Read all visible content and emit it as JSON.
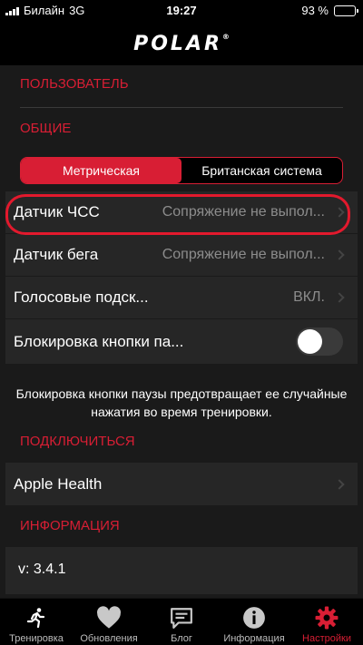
{
  "status": {
    "carrier": "Билайн",
    "network": "3G",
    "time": "19:27",
    "battery": "93 %",
    "battery_level": 0.93
  },
  "header": {
    "logo": "POLAR",
    "logo_mark": "®"
  },
  "sections": {
    "user": "ПОЛЬЗОВАТЕЛЬ",
    "general": "ОБЩИЕ",
    "connect": "ПОДКЛЮЧИТЬСЯ",
    "info": "ИНФОРМАЦИЯ"
  },
  "units": {
    "metric": "Метрическая",
    "imperial": "Британская система",
    "selected": "metric"
  },
  "settings": [
    {
      "label": "Датчик ЧСС",
      "value": "Сопряжение не выпол..."
    },
    {
      "label": "Датчик бега",
      "value": "Сопряжение не выпол..."
    },
    {
      "label": "Голосовые подск...",
      "value": "ВКЛ."
    },
    {
      "label": "Блокировка кнопки па...",
      "toggle": false
    }
  ],
  "pause_note": {
    "line1": "Блокировка кнопки паузы предотвращает ее случайные",
    "line2": "нажатия во время тренировки."
  },
  "connect": {
    "apple_health": "Apple Health"
  },
  "version": "v: 3.4.1",
  "tabs": [
    {
      "label": "Тренировка",
      "icon": "running-man-icon"
    },
    {
      "label": "Обновления",
      "icon": "heart-icon"
    },
    {
      "label": "Блог",
      "icon": "chat-bubble-icon"
    },
    {
      "label": "Информация",
      "icon": "info-icon"
    },
    {
      "label": "Настройки",
      "icon": "gear-icon",
      "active": true
    }
  ],
  "colors": {
    "accent": "#d81e34",
    "row_bg": "#262626",
    "bg": "#1a1a1a"
  }
}
